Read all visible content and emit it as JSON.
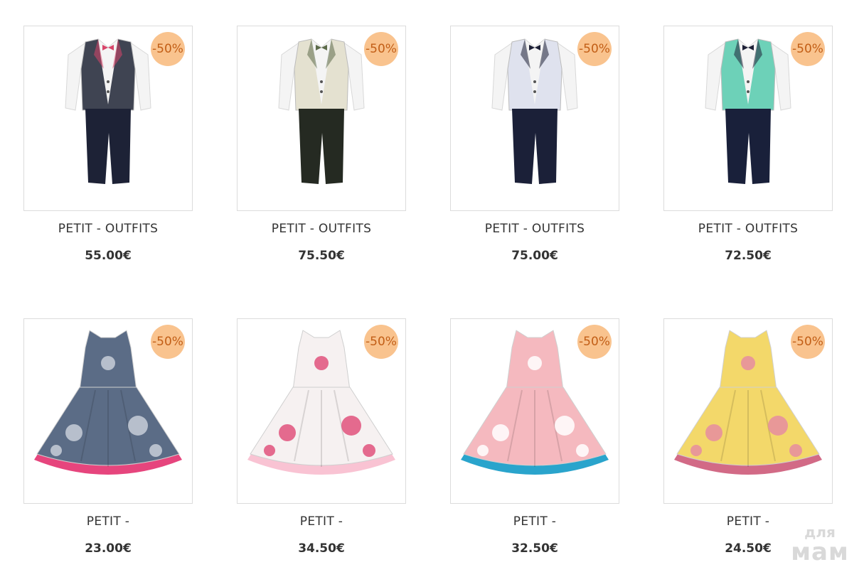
{
  "products": [
    {
      "title": "PETIT - OUTFITS",
      "price": "55.00€",
      "badge": "-50%",
      "image": "boys-suit-grey-vest-icon",
      "colors": {
        "jacket": "#3f4452",
        "pants": "#1d2236",
        "shirt": "#f4f4f4",
        "accent": "#d8456a"
      }
    },
    {
      "title": "PETIT - OUTFITS",
      "price": "75.50€",
      "badge": "-50%",
      "image": "boys-palm-print-blazer-icon",
      "colors": {
        "jacket": "#e4e1d0",
        "pants": "#252a22",
        "shirt": "#f4f4f4",
        "accent": "#5c6b4a"
      }
    },
    {
      "title": "PETIT - OUTFITS",
      "price": "75.00€",
      "badge": "-50%",
      "image": "boys-floral-tuxedo-icon",
      "colors": {
        "jacket": "#dfe2ee",
        "pants": "#1b2038",
        "shirt": "#f4f4f4",
        "accent": "#1d2036"
      }
    },
    {
      "title": "PETIT - OUTFITS",
      "price": "72.50€",
      "badge": "-50%",
      "image": "boys-mint-blazer-icon",
      "colors": {
        "jacket": "#6dd1b8",
        "pants": "#19203a",
        "shirt": "#f4f4f4",
        "accent": "#1d2036"
      }
    },
    {
      "title": "PETIT -",
      "price": "23.00€",
      "badge": "-50%",
      "image": "girls-navy-floral-dress-icon",
      "colors": {
        "dress": "#5b6c86",
        "lining": "#e6457d",
        "flower": "#c8ced8"
      }
    },
    {
      "title": "PETIT -",
      "price": "34.50€",
      "badge": "-50%",
      "image": "girls-white-floral-tulle-dress-icon",
      "colors": {
        "dress": "#f6f1f1",
        "lining": "#f9c3d3",
        "flower": "#e0527d"
      }
    },
    {
      "title": "PETIT -",
      "price": "32.50€",
      "badge": "-50%",
      "image": "girls-pink-blue-stripe-dress-icon",
      "colors": {
        "dress": "#f5b9bf",
        "lining": "#2aa4cc",
        "flower": "#ffffff"
      }
    },
    {
      "title": "PETIT -",
      "price": "24.50€",
      "badge": "-50%",
      "image": "girls-yellow-floral-dress-icon",
      "colors": {
        "dress": "#f3d86a",
        "lining": "#d26a86",
        "flower": "#e58da0"
      }
    }
  ],
  "watermark": {
    "line1": "для",
    "line2": "мам"
  }
}
